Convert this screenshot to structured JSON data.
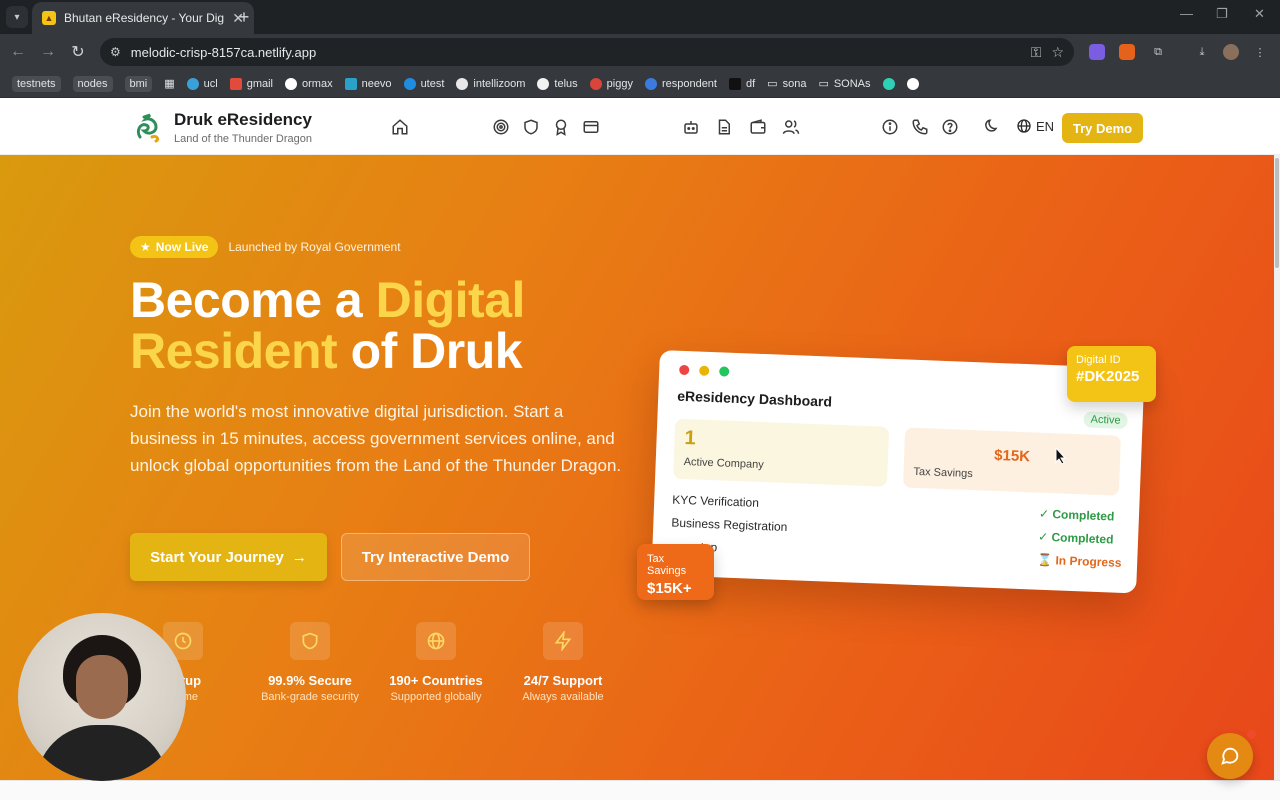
{
  "browser": {
    "tab_title": "Bhutan eResidency - Your Digit",
    "url": "melodic-crisp-8157ca.netlify.app",
    "bookmarks": [
      {
        "label": "testnets",
        "chip": true
      },
      {
        "label": "nodes",
        "chip": true
      },
      {
        "label": "bmi",
        "chip": true
      },
      {
        "label": "ucl",
        "chip": false
      },
      {
        "label": "gmail",
        "chip": false
      },
      {
        "label": "ormax",
        "chip": false
      },
      {
        "label": "neevo",
        "chip": false
      },
      {
        "label": "utest",
        "chip": false
      },
      {
        "label": "intellizoom",
        "chip": false
      },
      {
        "label": "telus",
        "chip": false
      },
      {
        "label": "piggy",
        "chip": false
      },
      {
        "label": "respondent",
        "chip": false
      },
      {
        "label": "df",
        "chip": false
      },
      {
        "label": "sona",
        "chip": false
      },
      {
        "label": "SONAs",
        "chip": false
      }
    ]
  },
  "header": {
    "brand_name": "Druk eResidency",
    "brand_tagline": "Land of the Thunder Dragon",
    "lang": "EN",
    "try_demo": "Try Demo",
    "icons": [
      "home-icon",
      "target-icon",
      "shield-icon",
      "award-icon",
      "card-icon",
      "bot-icon",
      "document-icon",
      "wallet-icon",
      "users-icon",
      "info-icon",
      "phone-icon",
      "help-icon",
      "moon-icon",
      "globe-icon"
    ]
  },
  "hero": {
    "badge": "Now Live",
    "badge_sub": "Launched by Royal Government",
    "headline_1": "Become a ",
    "headline_gold_1": "Digital",
    "headline_gold_2": "Resident",
    "headline_2": " of Druk",
    "description": "Join the world's most innovative digital jurisdiction. Start a business in 15 minutes, access government services online, and unlock global opportunities from the Land of the Thunder Dragon.",
    "cta_primary": "Start Your Journey",
    "cta_secondary": "Try Interactive Demo",
    "stats": [
      {
        "title": "Setup",
        "sub": "e time",
        "icon": "clock-icon"
      },
      {
        "title": "99.9% Secure",
        "sub": "Bank-grade security",
        "icon": "shield-icon"
      },
      {
        "title": "190+ Countries",
        "sub": "Supported globally",
        "icon": "globe-icon"
      },
      {
        "title": "24/7 Support",
        "sub": "Always available",
        "icon": "zap-icon"
      }
    ]
  },
  "dashboard": {
    "title": "eResidency Dashboard",
    "active": "Active",
    "kpi1_value": "1",
    "kpi1_label": "Active Company",
    "kpi2_value": "$15K",
    "kpi2_label": "Tax Savings",
    "tasks": [
      {
        "label": "KYC Verification",
        "status": "✓ Completed"
      },
      {
        "label": "Business Registration",
        "status": "✓ Completed"
      },
      {
        "label": "tup",
        "status": "⌛ In Progress"
      }
    ]
  },
  "floats": {
    "digital_id_label": "Digital ID",
    "digital_id_value": "#DK2025",
    "tax_label": "Tax Savings",
    "tax_value": "$15K+"
  },
  "colors": {
    "accent_gold": "#e4b512",
    "hero_orange": "#ea5f17",
    "headline_gold": "#fbd54a",
    "success_green": "#2f9a46"
  }
}
